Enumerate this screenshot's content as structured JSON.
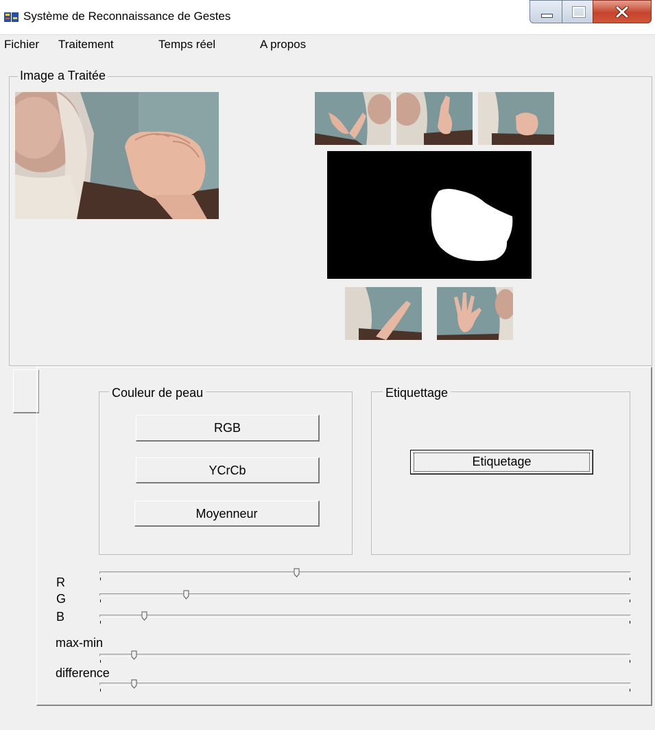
{
  "window": {
    "title": "Système de Reconnaissance de Gestes"
  },
  "menu": {
    "items": [
      "Fichier",
      "Traitement",
      "Temps réel",
      "A propos"
    ]
  },
  "image_group": {
    "title": "Image a Traitée"
  },
  "skin_group": {
    "title": "Couleur de peau",
    "buttons": [
      "RGB",
      "YCrCb",
      "Moyenneur"
    ]
  },
  "label_group": {
    "title": "Etiquettage",
    "button": "Etiquetage"
  },
  "sliders": [
    {
      "label": "R",
      "value": 0.37
    },
    {
      "label": "G",
      "value": 0.16
    },
    {
      "label": "B",
      "value": 0.08
    },
    {
      "label": "max-min",
      "value": 0.06
    },
    {
      "label": "difference",
      "value": 0.06
    }
  ],
  "colors": {
    "accent_close": "#c4442c",
    "background": "#f0f0f0"
  },
  "icons": [
    "app-icon",
    "minimize-icon",
    "maximize-icon",
    "close-icon"
  ]
}
